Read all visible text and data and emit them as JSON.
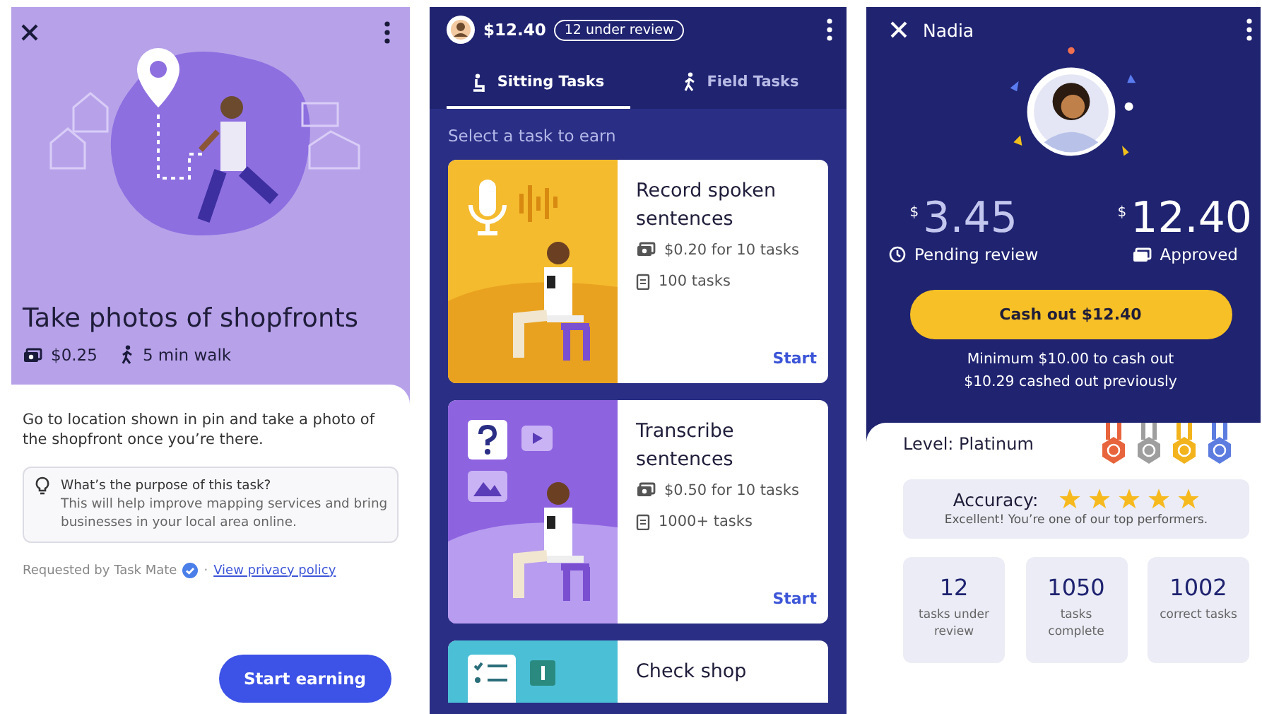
{
  "task_detail": {
    "title": "Take photos of shopfronts",
    "price": "$0.25",
    "duration": "5 min walk",
    "description": "Go to location shown in pin and take a photo of the shopfront once you’re there.",
    "info": {
      "heading": "What’s the purpose of this task?",
      "body": "This will help improve mapping services and bring businesses in your local area online."
    },
    "requested_by": "Requested by Task Mate",
    "separator": "·",
    "privacy_link": "View privacy policy",
    "button": "Start earning"
  },
  "task_list": {
    "balance": "$12.40",
    "review_badge": "12 under review",
    "tabs": [
      {
        "kind": "sitting",
        "label": "Sitting Tasks",
        "selected": true
      },
      {
        "kind": "field",
        "label": "Field Tasks",
        "selected": false
      }
    ],
    "prompt": "Select a task to earn",
    "cards": [
      {
        "kind": "record",
        "title": "Record spoken sentences",
        "pay": "$0.20 for 10 tasks",
        "count": "100 tasks",
        "action": "Start"
      },
      {
        "kind": "transcribe",
        "title": "Transcribe sentences",
        "pay": "$0.50 for 10 tasks",
        "count": "1000+ tasks",
        "action": "Start"
      },
      {
        "kind": "shop",
        "title": "Check shop"
      }
    ]
  },
  "profile": {
    "name": "Nadia",
    "amounts": [
      {
        "kind": "pending",
        "symbol": "$",
        "amount": "3.45",
        "label": "Pending review"
      },
      {
        "kind": "approved",
        "symbol": "$",
        "amount": "12.40",
        "label": "Approved"
      }
    ],
    "cash_out_button": "Cash out $12.40",
    "notes": [
      "Minimum $10.00 to cash out",
      "$10.29 cashed out previously"
    ],
    "level": "Level: Platinum",
    "medals": [
      {
        "color": "#e8643c"
      },
      {
        "color": "#9e9e9e"
      },
      {
        "color": "#f2b31c"
      },
      {
        "color": "#5c7ce0"
      }
    ],
    "accuracy": {
      "label": "Accuracy:",
      "stars": 5,
      "message": "Excellent! You’re one of our top performers."
    },
    "stats": [
      {
        "value": "12",
        "label": "tasks under review"
      },
      {
        "value": "1050",
        "label": "tasks complete"
      },
      {
        "value": "1002",
        "label": "correct tasks"
      }
    ]
  }
}
